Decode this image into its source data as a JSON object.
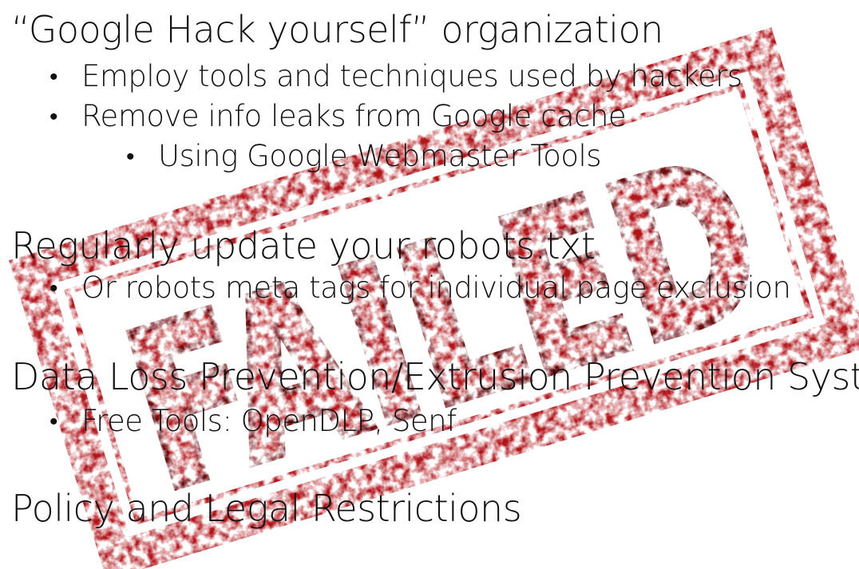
{
  "stamp": {
    "word": "FAILED",
    "color": "#b01218"
  },
  "sections": [
    {
      "heading": "“Google Hack yourself” organization",
      "items": [
        "Employ tools and techniques used by hackers",
        "Remove info leaks from Google cache"
      ],
      "subitems": [
        "Using Google Webmaster Tools"
      ]
    },
    {
      "heading": "Regularly update your robots.txt",
      "items": [
        "Or robots meta tags for individual page exclusion"
      ]
    },
    {
      "heading": "Data Loss Prevention/Extrusion Prevention Systems",
      "items": [
        "Free Tools: OpenDLP, Senf"
      ]
    },
    {
      "heading": "Policy and Legal Restrictions"
    }
  ],
  "bullet_glyph": "•"
}
